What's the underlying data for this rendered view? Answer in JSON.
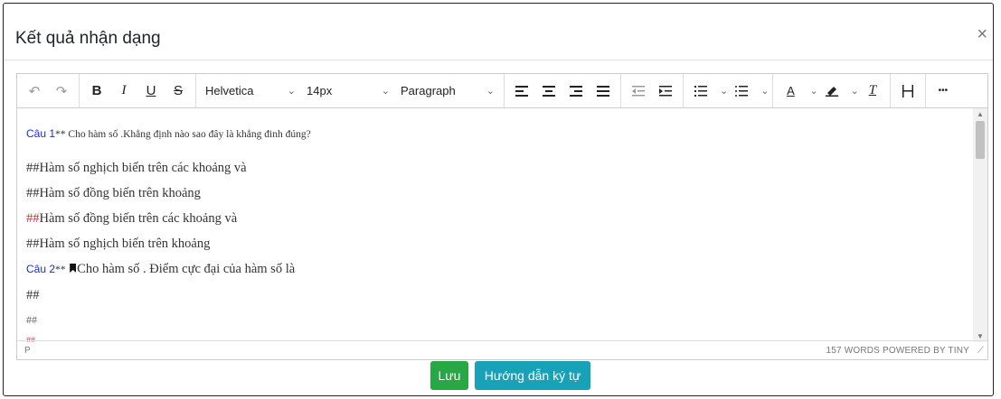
{
  "dialog": {
    "title": "Kết quả nhận dạng",
    "close_label": "×"
  },
  "toolbar": {
    "undo": "↶",
    "redo": "↷",
    "bold": "B",
    "italic": "I",
    "underline": "U",
    "strike": "S",
    "font_family": "Helvetica",
    "font_size": "14px",
    "block_format": "Paragraph",
    "more": "•••"
  },
  "content": {
    "q1_label": "Câu 1",
    "q1_stars": "**",
    "q1_text": " Cho hàm số .Khẳng định nào sao đây là khẳng đinh đúng?",
    "opt1": "##Hàm số nghịch biến trên các khoảng và",
    "opt2": "##Hàm số đồng biến trên khoảng",
    "opt3_mark": "##",
    "opt3_text": "Hàm số đồng biến trên các khoảng và",
    "opt4": "##Hàm số nghịch biến trên khoảng",
    "q2_label": "Câu 2",
    "q2_stars": "**",
    "q2_text": "Cho hàm số . Điểm cực đại của hàm số là",
    "q2_opt1": "##",
    "q2_opt2": "##",
    "q2_opt3": "##"
  },
  "statusbar": {
    "path": "P",
    "wordcount": "157 WORDS",
    "powered": "POWERED BY TINY"
  },
  "buttons": {
    "save": "Lưu",
    "guide": "Hướng dẫn ký tự"
  },
  "colors": {
    "save": "#28a745",
    "guide": "#17a2b8",
    "question": "#1a2bd6",
    "answer_mark": "#d32f2f"
  },
  "icons": [
    "undo-icon",
    "redo-icon",
    "bold-icon",
    "italic-icon",
    "underline-icon",
    "strikethrough-icon",
    "align-left-icon",
    "align-center-icon",
    "align-right-icon",
    "align-justify-icon",
    "outdent-icon",
    "indent-icon",
    "numbered-list-icon",
    "bullet-list-icon",
    "text-color-icon",
    "highlight-icon",
    "clear-format-icon",
    "page-break-icon",
    "more-icon"
  ]
}
